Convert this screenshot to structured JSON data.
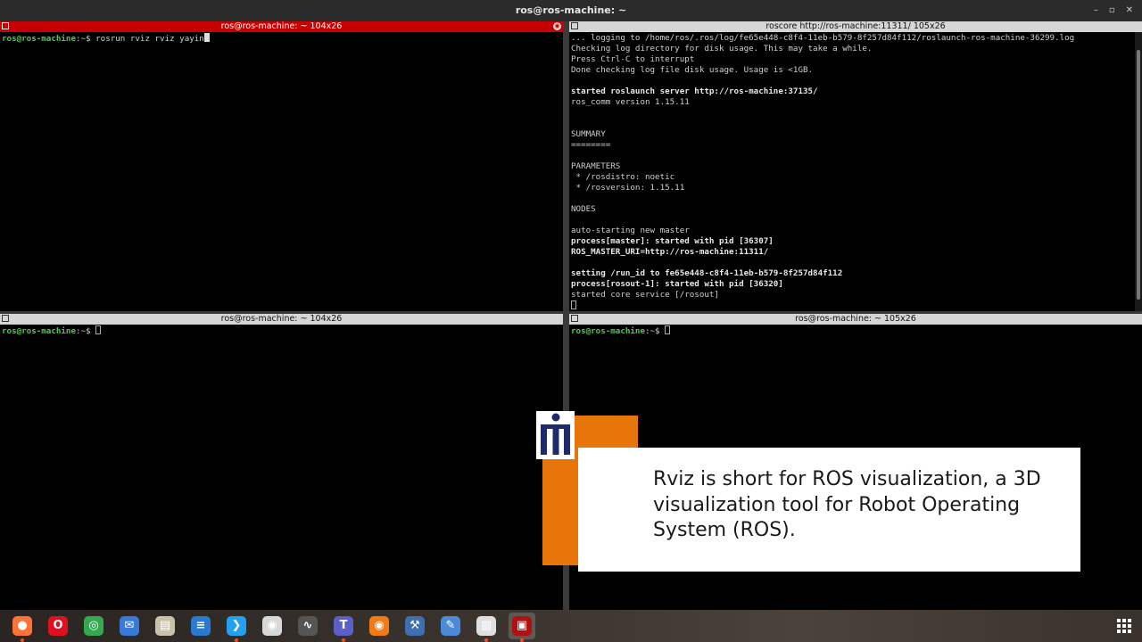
{
  "window": {
    "title": "ros@ros-machine: ~"
  },
  "panes": {
    "top_left": {
      "header": "ros@ros-machine: ~ 104x26",
      "prompt_user": "ros@ros-machine",
      "prompt_rest": ":~$ ",
      "command": "rosrun rviz rviz yayin"
    },
    "top_right": {
      "header": "roscore http://ros-machine:11311/ 105x26",
      "lines": [
        {
          "t": "... logging to /home/ros/.ros/log/fe65e448-c8f4-11eb-b579-8f257d84f112/roslaunch-ros-machine-36299.log",
          "b": false
        },
        {
          "t": "Checking log directory for disk usage. This may take a while.",
          "b": false
        },
        {
          "t": "Press Ctrl-C to interrupt",
          "b": false
        },
        {
          "t": "Done checking log file disk usage. Usage is <1GB.",
          "b": false
        },
        {
          "t": "",
          "b": false
        },
        {
          "t": "started roslaunch server http://ros-machine:37135/",
          "b": true
        },
        {
          "t": "ros_comm version 1.15.11",
          "b": false
        },
        {
          "t": "",
          "b": false
        },
        {
          "t": "",
          "b": false
        },
        {
          "t": "SUMMARY",
          "b": false
        },
        {
          "t": "========",
          "b": false
        },
        {
          "t": "",
          "b": false
        },
        {
          "t": "PARAMETERS",
          "b": false
        },
        {
          "t": " * /rosdistro: noetic",
          "b": false
        },
        {
          "t": " * /rosversion: 1.15.11",
          "b": false
        },
        {
          "t": "",
          "b": false
        },
        {
          "t": "NODES",
          "b": false
        },
        {
          "t": "",
          "b": false
        },
        {
          "t": "auto-starting new master",
          "b": false
        },
        {
          "t": "process[master]: started with pid [36307]",
          "b": true
        },
        {
          "t": "ROS_MASTER_URI=http://ros-machine:11311/",
          "b": true
        },
        {
          "t": "",
          "b": false
        },
        {
          "t": "setting /run_id to fe65e448-c8f4-11eb-b579-8f257d84f112",
          "b": true
        },
        {
          "t": "process[rosout-1]: started with pid [36320]",
          "b": true
        },
        {
          "t": "started core service [/rosout]",
          "b": false
        }
      ]
    },
    "bottom_left": {
      "header": "ros@ros-machine: ~ 104x26",
      "prompt_user": "ros@ros-machine",
      "prompt_rest": ":~$ "
    },
    "bottom_right": {
      "header": "ros@ros-machine: ~ 105x26",
      "prompt_user": "ros@ros-machine",
      "prompt_rest": ":~$ "
    }
  },
  "overlay": {
    "caption": "Rviz is short for ROS visualization, a 3D visualization tool for Robot Operating System (ROS).",
    "accent_color": "#e8750a"
  },
  "taskbar": {
    "apps": [
      {
        "name": "firefox-icon",
        "color": "#ff7139",
        "running": true
      },
      {
        "name": "opera-icon",
        "color": "#e01020",
        "running": false
      },
      {
        "name": "chrome-icon",
        "color": "#34a853",
        "running": false
      },
      {
        "name": "thunderbird-icon",
        "color": "#3a7ad4",
        "running": false
      },
      {
        "name": "files-icon",
        "color": "#c9c2a8",
        "running": false
      },
      {
        "name": "writer-icon",
        "color": "#2a7ad0",
        "running": false
      },
      {
        "name": "vscode-icon",
        "color": "#24a0f0",
        "running": true
      },
      {
        "name": "screenshot-icon",
        "color": "#d8d8d8",
        "running": false
      },
      {
        "name": "system-monitor-icon",
        "color": "#555555",
        "running": false
      },
      {
        "name": "teams-icon",
        "color": "#5b5fc7",
        "running": true
      },
      {
        "name": "blender-icon",
        "color": "#f07a15",
        "running": false
      },
      {
        "name": "settings-tool-icon",
        "color": "#3f6fb0",
        "running": false
      },
      {
        "name": "text-editor-icon",
        "color": "#4a8ad8",
        "running": false
      },
      {
        "name": "document-viewer-icon",
        "color": "#e0e0e0",
        "running": true
      },
      {
        "name": "terminator-icon",
        "color": "#b01010",
        "running": true
      }
    ]
  }
}
